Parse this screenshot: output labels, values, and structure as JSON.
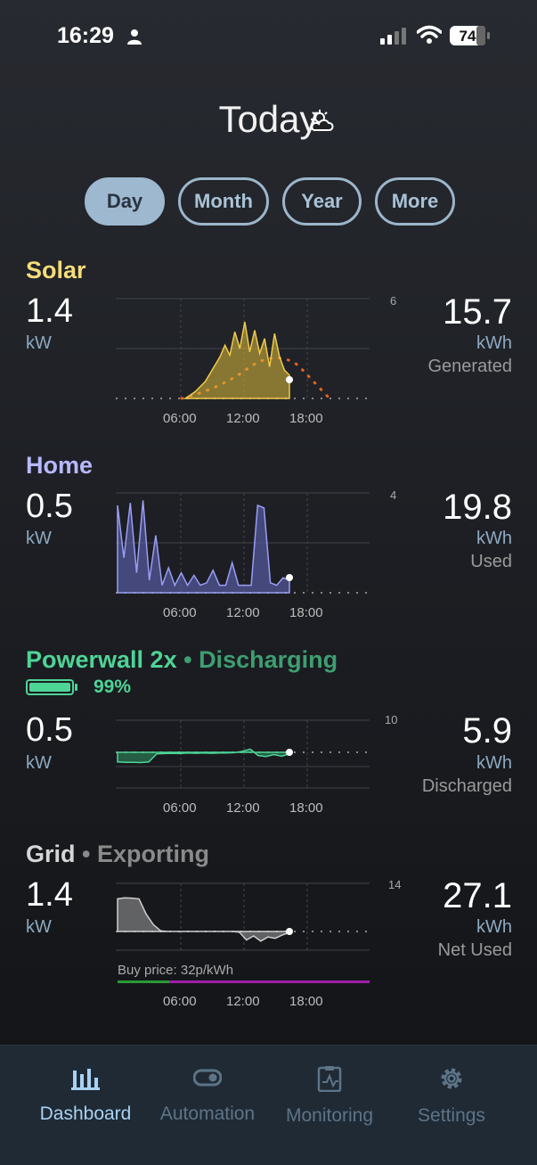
{
  "status": {
    "time": "16:29",
    "battery": "74"
  },
  "header": {
    "title": "Today"
  },
  "tabs": [
    "Day",
    "Month",
    "Year",
    "More"
  ],
  "solar": {
    "title": "Solar",
    "value": "1.4",
    "unit": "kW",
    "total": "15.7",
    "total_unit": "kWh",
    "total_label": "Generated",
    "axis_max": "6",
    "color": "#f4dc79"
  },
  "home": {
    "title": "Home",
    "value": "0.5",
    "unit": "kW",
    "total": "19.8",
    "total_unit": "kWh",
    "total_label": "Used",
    "axis_max": "4",
    "color": "#b7b8ff"
  },
  "powerwall": {
    "title": "Powerwall 2x",
    "state": "• Discharging",
    "charge": "99%",
    "value": "0.5",
    "unit": "kW",
    "total": "5.9",
    "total_unit": "kWh",
    "total_label": "Discharged",
    "axis_max": "10",
    "color": "#4ed496"
  },
  "grid": {
    "title": "Grid",
    "state": "• Exporting",
    "value": "1.4",
    "unit": "kW",
    "total": "27.1",
    "total_unit": "kWh",
    "total_label": "Net Used",
    "axis_max": "14",
    "price": "Buy price: 32p/kWh"
  },
  "x_ticks": [
    "06:00",
    "12:00",
    "18:00"
  ],
  "nav": [
    "Dashboard",
    "Automation",
    "Monitoring",
    "Settings"
  ],
  "chart_data": [
    {
      "type": "area",
      "title": "Solar",
      "ylim": [
        0,
        6
      ],
      "x_ticks": [
        "06:00",
        "12:00",
        "18:00"
      ],
      "series": [
        {
          "values": [
            0,
            0,
            0,
            0,
            0,
            0,
            0,
            0,
            0,
            0.2,
            0.4,
            0.7,
            1.0,
            1.5,
            2.0,
            2.5,
            3.2,
            2.6,
            4.0,
            3.0,
            4.6,
            2.8,
            4.1,
            2.7,
            3.6,
            1.9,
            3.9,
            2.5,
            1.7,
            1.4
          ]
        }
      ]
    },
    {
      "type": "area",
      "title": "Home",
      "ylim": [
        0,
        4
      ],
      "x_ticks": [
        "06:00",
        "12:00",
        "18:00"
      ],
      "series": [
        {
          "values": [
            3.5,
            1.4,
            3.6,
            0.8,
            3.7,
            0.5,
            2.3,
            0.3,
            1.0,
            0.3,
            0.8,
            0.3,
            0.7,
            0.3,
            0.4,
            0.9,
            0.3,
            0.3,
            1.2,
            0.3,
            0.3,
            0.3,
            3.5,
            3.4,
            0.4,
            0.3,
            0.6,
            0.5
          ]
        }
      ]
    },
    {
      "type": "area",
      "title": "Powerwall 2x",
      "ylim": [
        -10,
        10
      ],
      "x_ticks": [
        "06:00",
        "12:00",
        "18:00"
      ],
      "series": [
        {
          "values": [
            -3.0,
            -3.1,
            -3.1,
            -3.2,
            -3.0,
            -0.5,
            -0.4,
            -0.3,
            -0.4,
            -0.2,
            -0.3,
            -0.2,
            -0.3,
            -0.2,
            -0.2,
            -0.1,
            0.3,
            1.0,
            -1.0,
            -1.3,
            -0.7,
            -1.2,
            -0.5
          ]
        }
      ]
    },
    {
      "type": "area",
      "title": "Grid",
      "ylim": [
        -14,
        14
      ],
      "x_ticks": [
        "06:00",
        "12:00",
        "18:00"
      ],
      "series": [
        {
          "values": [
            9.5,
            9.8,
            9.7,
            9.5,
            5.0,
            2.0,
            0.2,
            0.0,
            0.0,
            0.0,
            0.0,
            0.0,
            0.0,
            0.0,
            0.0,
            0.0,
            0.0,
            -0.2,
            -2.5,
            -1.3,
            -2.8,
            -1.6,
            -2.0,
            -1.0,
            -0.3
          ]
        }
      ]
    }
  ]
}
